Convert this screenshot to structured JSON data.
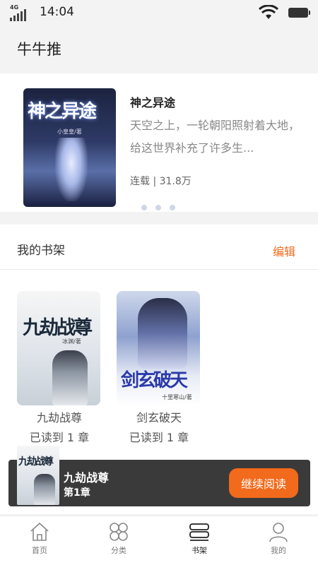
{
  "status_bar": {
    "network": "4G",
    "time": "14:04"
  },
  "header": {
    "title": "牛牛推"
  },
  "featured": {
    "cover_title": "神之异途",
    "cover_author": "小皇皇/著",
    "title": "神之异途",
    "description": "天空之上，一轮朝阳照射着大地，给这世界补充了许多生...",
    "meta": "连载 | 31.8万"
  },
  "shelf": {
    "label": "我的书架",
    "edit_label": "编辑",
    "books": [
      {
        "title": "九劫战尊",
        "progress": "已读到 1 章",
        "cover_title": "九劫战尊",
        "cover_author": "冰渊/著"
      },
      {
        "title": "剑玄破天",
        "progress": "已读到 1 章",
        "cover_title": "剑玄破天",
        "cover_author": "十里寒山/著"
      }
    ]
  },
  "continue_reading": {
    "book_title": "九劫战尊",
    "chapter": "第1章",
    "button_label": "继续阅读",
    "cover_title": "九劫战尊"
  },
  "tabbar": {
    "active_index": 2,
    "items": [
      {
        "label": "首页",
        "icon": "home-icon"
      },
      {
        "label": "分类",
        "icon": "category-icon"
      },
      {
        "label": "书架",
        "icon": "bookshelf-icon"
      },
      {
        "label": "我的",
        "icon": "profile-icon"
      }
    ]
  },
  "colors": {
    "accent": "#f26a1b",
    "continue_bar": "#3a3a3a",
    "background": "#f3f3f3"
  }
}
